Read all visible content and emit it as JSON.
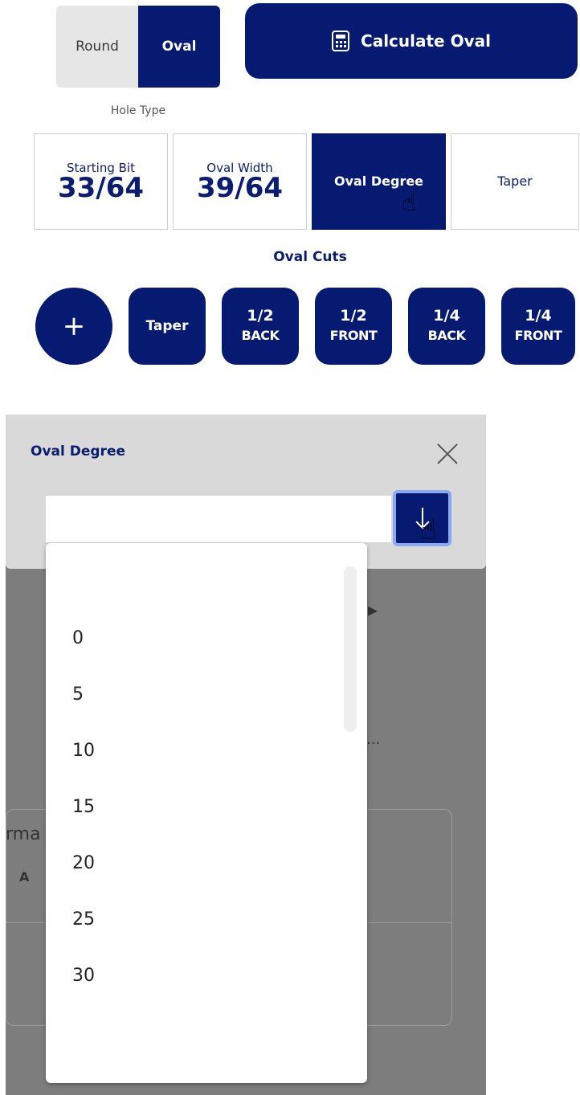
{
  "hole_type": {
    "options": [
      "Round",
      "Oval"
    ],
    "selected": "Oval",
    "label": "Hole Type"
  },
  "calculate_button": {
    "label": "Calculate Oval",
    "icon": "calculator-icon"
  },
  "params": [
    {
      "label": "Starting Bit",
      "value": "33/64"
    },
    {
      "label": "Oval Width",
      "value": "39/64"
    },
    {
      "label": "Oval Degree",
      "value": ""
    },
    {
      "label": "Taper",
      "value": ""
    }
  ],
  "oval_cuts": {
    "title": "Oval Cuts",
    "add_icon": "plus-icon",
    "add_label": "+",
    "cuts": [
      {
        "line1": "Taper",
        "line2": ""
      },
      {
        "line1": "1/2",
        "line2": "BACK"
      },
      {
        "line1": "1/2",
        "line2": "FRONT"
      },
      {
        "line1": "1/4",
        "line2": "BACK"
      },
      {
        "line1": "1/4",
        "line2": "FRONT"
      }
    ]
  },
  "dialog": {
    "title": "Oval Degree",
    "input_value": "",
    "options": [
      "0",
      "5",
      "10",
      "15",
      "20",
      "25",
      "30"
    ]
  },
  "background_fragments": {
    "text_ma": "rma",
    "text_a": "A"
  },
  "colors": {
    "navy": "#061a72",
    "toggle_inactive": "#e6e6e6",
    "dialog_header": "#d9d9d9",
    "backdrop": "#7d7d7d",
    "focus_ring": "#8aa8f0"
  }
}
